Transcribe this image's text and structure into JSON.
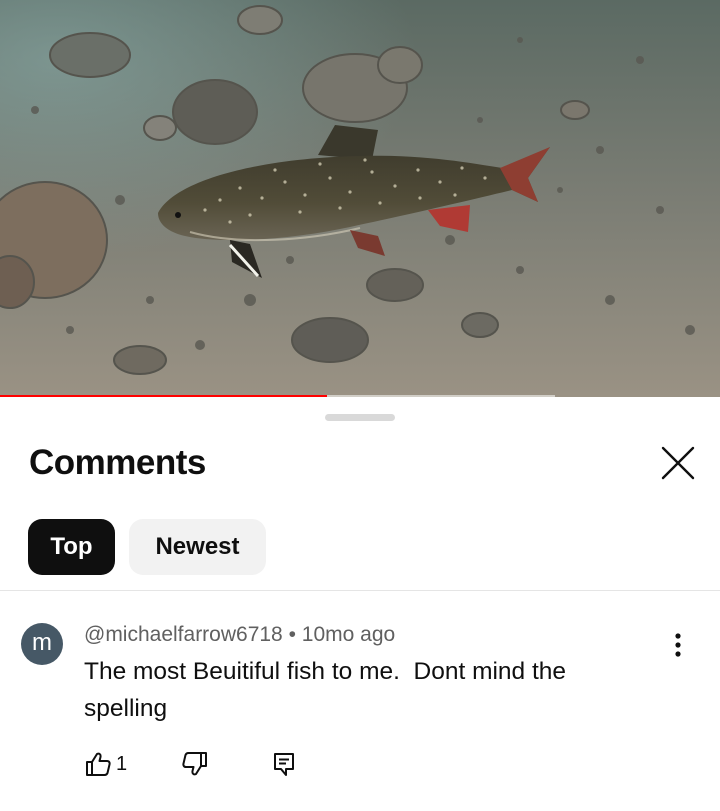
{
  "video": {
    "progress_fraction": 0.454,
    "buffered_fraction": 0.771,
    "progress_color": "#ff0000"
  },
  "comments_panel": {
    "title": "Comments",
    "close_icon": "close-icon",
    "filters": [
      {
        "label": "Top",
        "selected": true
      },
      {
        "label": "Newest",
        "selected": false
      }
    ]
  },
  "comment": {
    "avatar_letter": "m",
    "avatar_color": "#465866",
    "author": "@michaelfarrow6718",
    "separator": "•",
    "age": "10mo ago",
    "text": "The most Beuitiful fish to me.  Dont mind the spelling",
    "like_count": "1",
    "icons": [
      "thumb-up-icon",
      "thumb-down-icon",
      "reply-icon",
      "more-vert-icon"
    ]
  }
}
